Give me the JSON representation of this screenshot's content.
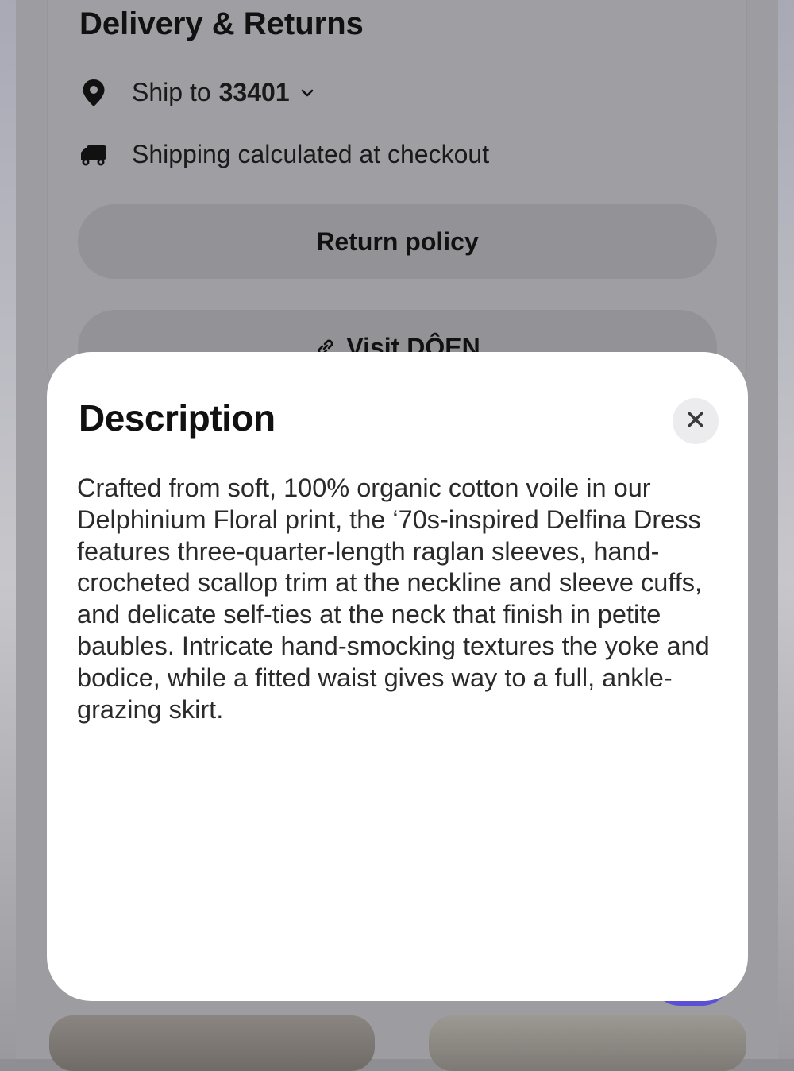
{
  "colors": {
    "accent_peek": "#5b4fd6",
    "modal_background": "#ffffff",
    "overlay_dim": "#9d9da1"
  },
  "background": {
    "section_title": "Delivery & Returns",
    "ship_to_label": "Ship to",
    "ship_to_zip": "33401",
    "ship_to_icon": "location-pin-icon",
    "shipping_text": "Shipping calculated at checkout",
    "shipping_icon": "truck-icon",
    "return_policy_label": "Return policy",
    "visit_label": "Visit DÔEN",
    "visit_icon": "link-icon"
  },
  "modal": {
    "title": "Description",
    "close_icon": "close-icon",
    "body": "Crafted from soft, 100% organic cotton voile in our Delphinium Floral print, the ‘70s-inspired Delfina Dress features three-quarter-length raglan sleeves, hand-crocheted scallop trim at the neckline and sleeve cuffs, and delicate self-ties at the neck that finish in petite baubles. Intricate hand-smocking textures the yoke and bodice, while a fitted waist gives way to a full, ankle-grazing skirt."
  }
}
